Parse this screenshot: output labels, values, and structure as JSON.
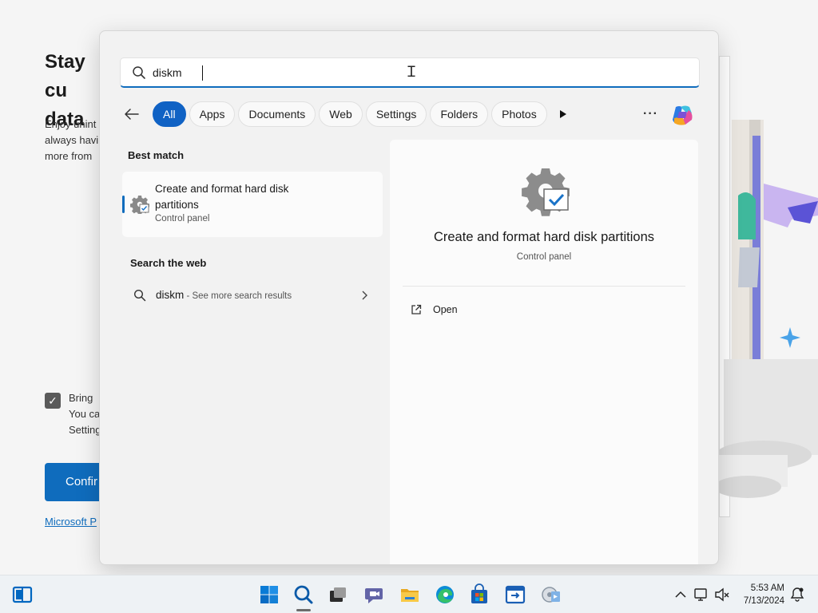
{
  "background": {
    "title": "Stay cu\ndata",
    "body": "Enjoy unint\nalways havi\nmore from",
    "checkbox_text": "Bring\nYou ca\nSetting",
    "confirm_label": "Confir",
    "link_text": "Microsoft P"
  },
  "search": {
    "query": "diskm",
    "filters": [
      "All",
      "Apps",
      "Documents",
      "Web",
      "Settings",
      "Folders",
      "Photos"
    ],
    "active_filter": "All",
    "more_label": "···"
  },
  "results": {
    "best_match_heading": "Best match",
    "best_match": {
      "title": "Create and format hard disk partitions",
      "category": "Control panel"
    },
    "web_heading": "Search the web",
    "web_result": {
      "term": "diskm",
      "suffix": " - See more search results"
    }
  },
  "preview": {
    "title": "Create and format hard disk partitions",
    "category": "Control panel",
    "actions": [
      {
        "label": "Open",
        "icon": "open-external-icon"
      }
    ]
  },
  "taskbar": {
    "apps": [
      "widgets-icon",
      "start-icon",
      "search-icon",
      "task-view-icon",
      "chat-icon",
      "file-explorer-icon",
      "edge-icon",
      "store-icon",
      "remote-app-icon",
      "media-app-icon"
    ],
    "time": "5:53 AM",
    "date": "7/13/2024"
  },
  "colors": {
    "accent": "#0f6cbd",
    "active_chip": "#1062c4"
  }
}
